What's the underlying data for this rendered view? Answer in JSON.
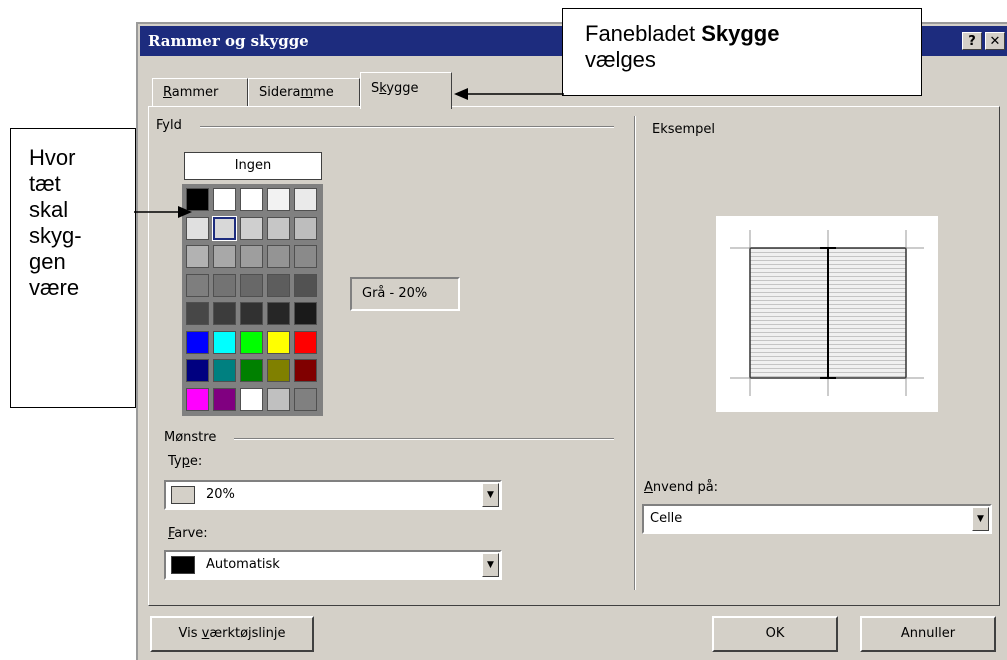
{
  "dialog": {
    "title": "Rammer og skygge",
    "help_btn": "?",
    "close_btn": "✕"
  },
  "tabs": {
    "rammer": {
      "pre": "",
      "key": "R",
      "post": "ammer"
    },
    "sideramme": {
      "pre": "Siderа",
      "key": "m",
      "post": "me"
    },
    "skygge": {
      "pre": "S",
      "key": "k",
      "post": "ygge"
    }
  },
  "fill": {
    "label": "Fyld",
    "none_label": "Ingen",
    "selected_name": "Grå - 20%",
    "swatch_colors": [
      [
        "#000000",
        "#ffffff",
        "#ffffff",
        "#f2f2f2",
        "#eaeaea"
      ],
      [
        "#e0e0e0",
        "#d8d8d8",
        "#cfcfcf",
        "#c6c6c6",
        "#bdbdbd"
      ],
      [
        "#b2b2b2",
        "#a8a8a8",
        "#9e9e9e",
        "#949494",
        "#8a8a8a"
      ],
      [
        "#7e7e7e",
        "#737373",
        "#686868",
        "#5d5d5d",
        "#525252"
      ],
      [
        "#474747",
        "#3c3c3c",
        "#313131",
        "#262626",
        "#1a1a1a"
      ],
      [
        "#0000ff",
        "#00ffff",
        "#00ff00",
        "#ffff00",
        "#ff0000"
      ],
      [
        "#000080",
        "#008080",
        "#008000",
        "#808000",
        "#800000"
      ],
      [
        "#ff00ff",
        "#800080",
        "#ffffff",
        "#c0c0c0",
        "#808080"
      ]
    ],
    "selected_swatch": [
      1,
      1
    ]
  },
  "patterns": {
    "label": "Mønstre",
    "type_label": {
      "pre": "Ty",
      "key": "p",
      "post": "e:"
    },
    "type_value": "20%",
    "type_swatch_color": "#d4d0c8",
    "color_label": {
      "pre": "",
      "key": "F",
      "post": "arve:"
    },
    "color_value": "Automatisk",
    "color_swatch_color": "#000000"
  },
  "preview": {
    "label": "Eksempel",
    "apply_label": {
      "pre": "",
      "key": "A",
      "post": "nvend på:"
    },
    "apply_value": "Celle"
  },
  "buttons": {
    "toolbar": {
      "pre": "Vis ",
      "key": "v",
      "post": "ærktøjslinje"
    },
    "ok": "OK",
    "cancel": "Annuller"
  },
  "callouts": {
    "tab_note_line1_pre": "Fanebladet ",
    "tab_note_line1_bold": "Skygge",
    "tab_note_line2": "vælges",
    "left_note": [
      "Hvor",
      "tæt",
      "skal",
      "skyg-",
      "gen",
      "være"
    ]
  },
  "colors": {
    "title_bar": "#1d2c7e",
    "dialog_face": "#d4d0c8"
  }
}
